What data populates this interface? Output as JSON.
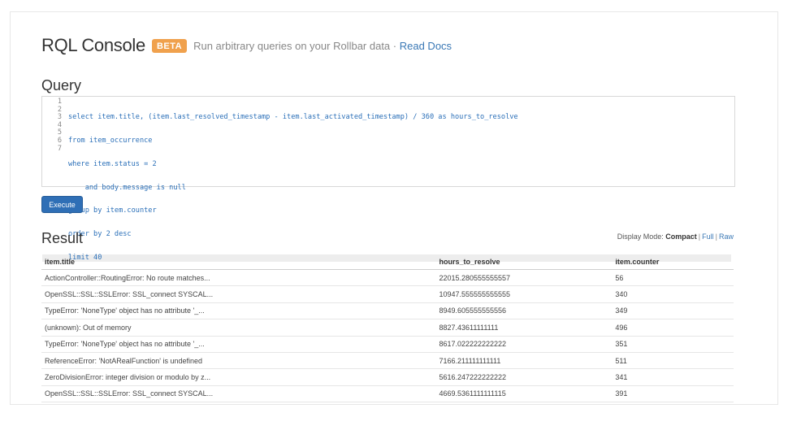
{
  "header": {
    "title": "RQL Console",
    "badge": "BETA",
    "subtitle": "Run arbitrary queries on your Rollbar data ·",
    "docs_link": "Read Docs"
  },
  "query": {
    "section_title": "Query",
    "line_numbers": [
      "1",
      "2",
      "3",
      "4",
      "5",
      "6",
      "7"
    ],
    "lines": [
      "select item.title, (item.last_resolved_timestamp - item.last_activated_timestamp) / 360 as hours_to_resolve",
      "from item_occurrence",
      "where item.status = 2",
      "    and body.message is null",
      "group by item.counter",
      "order by 2 desc",
      "limit 40"
    ]
  },
  "execute_button": "Execute",
  "result": {
    "section_title": "Result",
    "display_mode": {
      "label": "Display Mode:",
      "current": "Compact",
      "options": [
        "Full",
        "Raw"
      ]
    },
    "columns": [
      "item.title",
      "hours_to_resolve",
      "item.counter"
    ],
    "rows": [
      [
        "ActionController::RoutingError: No route matches...",
        "22015.280555555557",
        "56"
      ],
      [
        "OpenSSL::SSL::SSLError: SSL_connect SYSCAL...",
        "10947.555555555555",
        "340"
      ],
      [
        "TypeError: 'NoneType' object has no attribute '_...",
        "8949.605555555556",
        "349"
      ],
      [
        "(unknown): Out of memory",
        "8827.43611111111",
        "496"
      ],
      [
        "TypeError: 'NoneType' object has no attribute '_...",
        "8617.022222222222",
        "351"
      ],
      [
        "ReferenceError: 'NotARealFunction' is undefined",
        "7166.211111111111",
        "511"
      ],
      [
        "ZeroDivisionError: integer division or modulo by z...",
        "5616.247222222222",
        "341"
      ],
      [
        "OpenSSL::SSL::SSLError: SSL_connect SYSCAL...",
        "4669.5361111111115",
        "391"
      ]
    ]
  },
  "colors": {
    "badge": "#f0a14d",
    "link": "#3a78b5",
    "button": "#2f6fb6",
    "keyword": "#2a6fb8"
  }
}
